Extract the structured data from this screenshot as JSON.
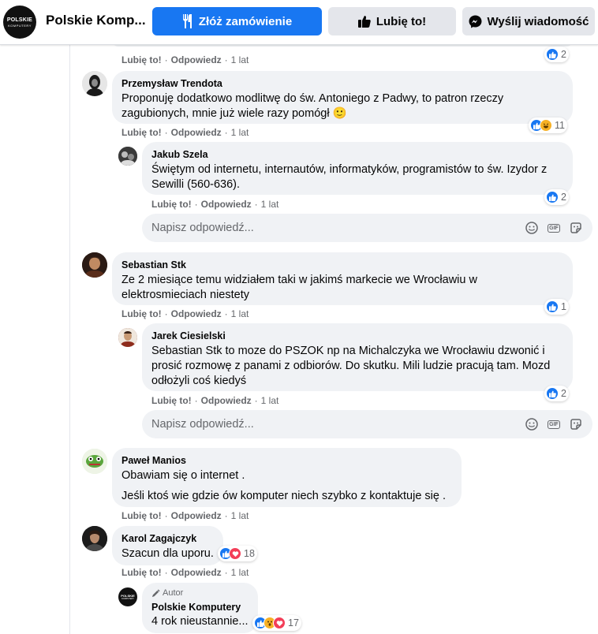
{
  "header": {
    "logo_line1": "POLSKIE",
    "logo_line2": "KOMPUTERY",
    "page_name": "Polskie Komp...",
    "order_button": "Złóż zamówienie",
    "like_button": "Lubię to!",
    "message_button": "Wyślij wiadomość"
  },
  "actions": {
    "like": "Lubię to!",
    "reply": "Odpowiedz",
    "sep": "·"
  },
  "reply_placeholder": "Napisz odpowiedź...",
  "top_action": {
    "age": "1 lat",
    "react_count": "2"
  },
  "comments": [
    {
      "author": "Przemysław Trendota",
      "text": "Proponuję dodatkowo modlitwę do św. Antoniego z Padwy, to patron rzeczy zagubionych, mnie już wiele razy pomógł 🙂",
      "age": "1 lat",
      "reactions": [
        "like",
        "haha"
      ],
      "react_count": "11"
    },
    {
      "author": "Jakub Szela",
      "text": "Świętym od internetu, internautów, informatyków, programistów to św. Izydor z Sewilli (560-636).",
      "age": "1 lat",
      "reactions": [
        "like"
      ],
      "react_count": "2"
    },
    {
      "author": "Sebastian Stk",
      "text": "Ze 2 miesiące temu widziałem taki w jakimś markecie we Wrocławiu w elektrosmieciach niestety",
      "age": "1 lat",
      "reactions": [
        "like"
      ],
      "react_count": "1"
    },
    {
      "author": "Jarek Ciesielski",
      "text": "Sebastian Stk to moze do PSZOK np na Michalczyka we Wrocławiu dzwonić i prosić rozmowę z panami z odbiorów. Do skutku. Mili ludzie pracują tam. Mozd odłożyli coś kiedyś",
      "age": "1 lat",
      "reactions": [
        "like"
      ],
      "react_count": "2"
    },
    {
      "author": "Paweł Manios",
      "text": "Obawiam się o internet .",
      "text2": "Jeśli ktoś wie gdzie ów komputer niech szybko z kontaktuje się .",
      "age": "1 lat"
    },
    {
      "author": "Karol Zagajczyk",
      "text": "Szacun dla uporu.",
      "age": "1 lat",
      "reactions": [
        "like",
        "love"
      ],
      "react_count": "18"
    },
    {
      "author": "Polskie Komputery",
      "badge": "Autor",
      "text": "4 rok nieustannie...",
      "reactions": [
        "like",
        "wow",
        "love"
      ],
      "react_count": "17"
    }
  ],
  "colors": {
    "brand_blue": "#1877f2",
    "bubble_bg": "#f0f2f5",
    "secondary_text": "#65676b",
    "love_red": "#f33e58",
    "haha_yellow": "#f7b125"
  }
}
